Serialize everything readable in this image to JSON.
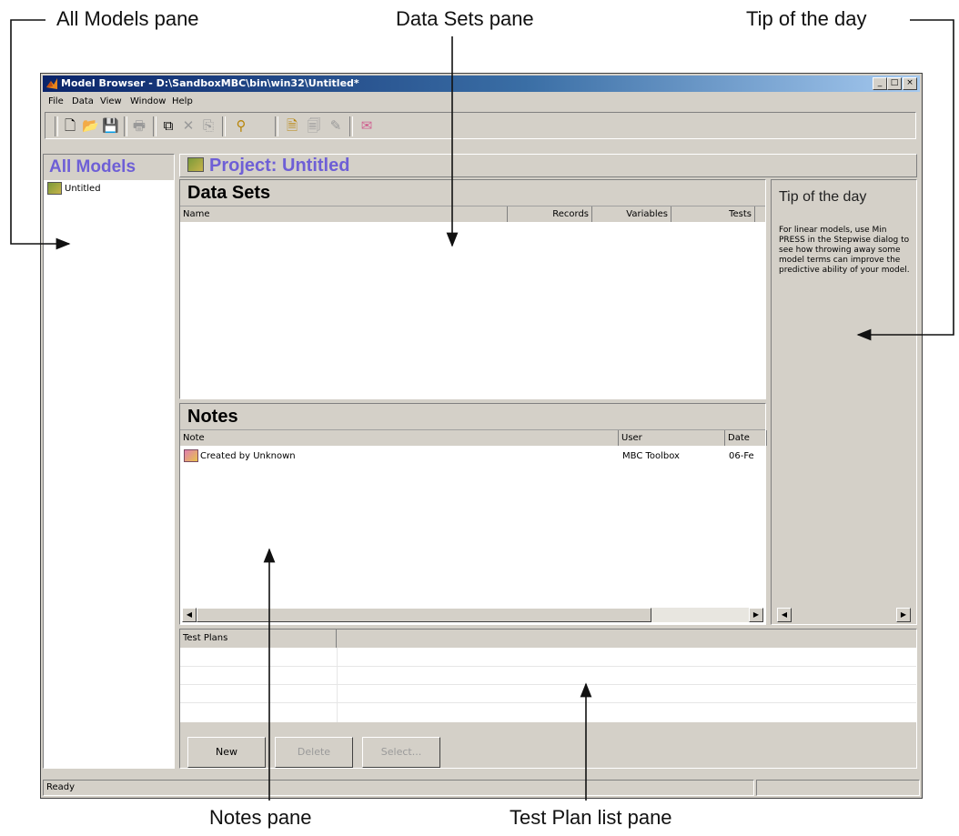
{
  "callouts": {
    "all_models": "All Models pane",
    "data_sets": "Data Sets pane",
    "tip": "Tip of the day",
    "notes": "Notes pane",
    "test_plan": "Test Plan list pane"
  },
  "window": {
    "title": "Model Browser - D:\\SandboxMBC\\bin\\win32\\Untitled*",
    "controls": {
      "minimize": "_",
      "maximize": "□",
      "close": "×"
    }
  },
  "menu": [
    "File",
    "Data",
    "View",
    "Window",
    "Help"
  ],
  "toolbar_icons": [
    "new-file-icon",
    "open-folder-icon",
    "save-icon",
    "print-icon",
    "copy-icon",
    "delete-icon",
    "paste-icon",
    "help-icon",
    "dataset-icon",
    "copy-dataset-icon",
    "edit-dataset-icon",
    "notes-icon"
  ],
  "all_models": {
    "header": "All Models",
    "items": [
      "Untitled"
    ]
  },
  "project": {
    "title": "Project: Untitled"
  },
  "data_sets": {
    "title": "Data Sets",
    "columns": [
      "Name",
      "Records",
      "Variables",
      "Tests"
    ]
  },
  "notes": {
    "title": "Notes",
    "columns": [
      "Note",
      "User",
      "Date"
    ],
    "rows": [
      {
        "note": "Created by Unknown",
        "user": "MBC Toolbox",
        "date": "06-Fe"
      }
    ]
  },
  "tip": {
    "title": "Tip of the day",
    "text": "For linear models, use Min PRESS in the Stepwise dialog to see how throwing away some model terms can improve the predictive ability of your model."
  },
  "test_plans": {
    "header": "Test Plans",
    "buttons": {
      "new": "New",
      "delete": "Delete",
      "select": "Select..."
    }
  },
  "status": {
    "text": "Ready"
  },
  "colors": {
    "accent": "#6e5fd6",
    "chrome": "#d4d0c8",
    "titlebar": "#0a246a"
  }
}
